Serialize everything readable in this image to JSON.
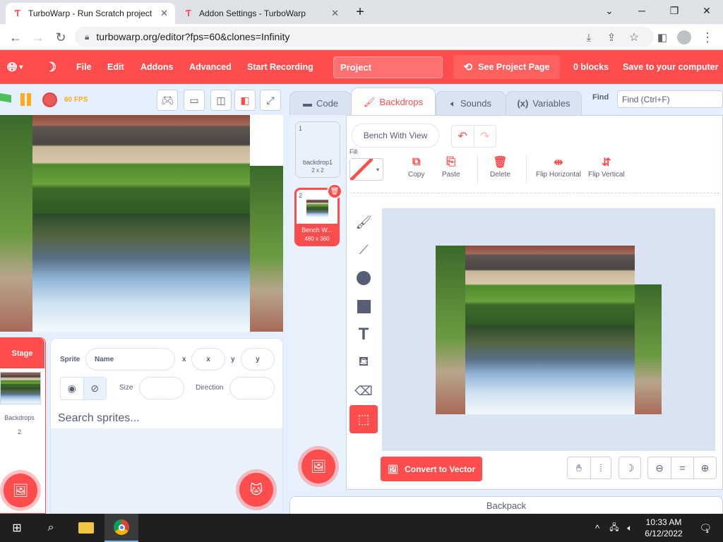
{
  "browser": {
    "tabs": [
      {
        "title": "TurboWarp - Run Scratch project",
        "active": true
      },
      {
        "title": "Addon Settings - TurboWarp",
        "active": false
      }
    ],
    "new_tab": "+",
    "url": "turbowarp.org/editor?fps=60&clones=Infinity"
  },
  "menu": {
    "items": [
      "File",
      "Edit",
      "Addons",
      "Advanced",
      "Start Recording"
    ],
    "project_title": "Project",
    "see_project_page": "See Project Page",
    "blocks": "0 blocks",
    "save": "Save to your computer"
  },
  "stage": {
    "fps": "60 FPS"
  },
  "sprite_info": {
    "sprite_label": "Sprite",
    "name_placeholder": "Name",
    "x_label": "x",
    "x_placeholder": "x",
    "y_label": "y",
    "y_placeholder": "y",
    "size_label": "Size",
    "direction_label": "Direction"
  },
  "stage_selector": {
    "header": "Stage",
    "backdrops_label": "Backdrops",
    "backdrops_count": "2"
  },
  "sprite_list": {
    "search_placeholder": "Search sprites..."
  },
  "editor_tabs": {
    "code": "Code",
    "backdrops": "Backdrops",
    "sounds": "Sounds",
    "variables": "Variables",
    "active": "Backdrops"
  },
  "find": {
    "label": "Find",
    "placeholder": "Find (Ctrl+F)"
  },
  "costumes": [
    {
      "index": "1",
      "name": "backdrop1",
      "size": "2 x 2",
      "selected": false
    },
    {
      "index": "2",
      "name": "Bench W...",
      "size": "480 x 360",
      "selected": true
    }
  ],
  "paint": {
    "costume_name": "Bench With View",
    "fill_label": "Fill",
    "copy": "Copy",
    "paste": "Paste",
    "delete": "Delete",
    "flip_horizontal": "Flip Horizontal",
    "flip_vertical": "Flip Vertical",
    "convert_to_vector": "Convert to Vector",
    "zoom_reset": "="
  },
  "backpack": "Backpack",
  "taskbar": {
    "time": "10:33 AM",
    "date": "6/12/2022",
    "notification_count": "1"
  },
  "colors": {
    "accent": "#ff4c4c",
    "panel_bg": "#e5f0ff",
    "text": "#575e75"
  }
}
